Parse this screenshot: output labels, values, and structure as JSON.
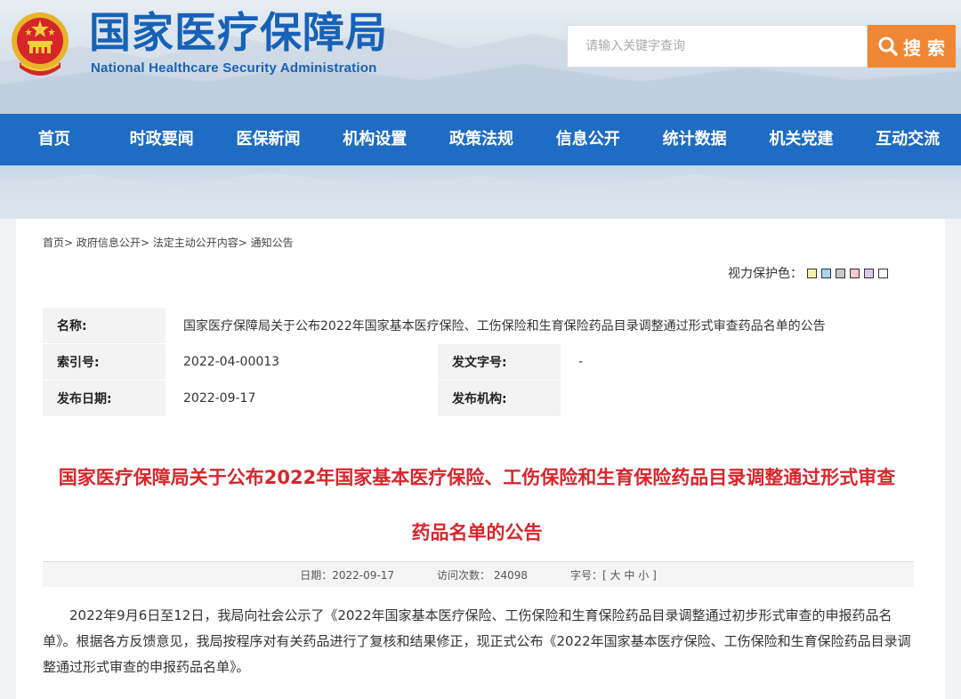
{
  "header": {
    "title": "国家医疗保障局",
    "subtitle": "National Healthcare Security Administration",
    "search_placeholder": "请输入关键字查询",
    "search_button": "搜 索"
  },
  "nav": {
    "items": [
      "首页",
      "时政要闻",
      "医保新闻",
      "机构设置",
      "政策法规",
      "信息公开",
      "统计数据",
      "机关党建",
      "互动交流"
    ]
  },
  "breadcrumb": {
    "items": [
      "首页>",
      "政府信息公开>",
      "法定主动公开内容>",
      "通知公告"
    ]
  },
  "eye_care": {
    "label": "视力保护色：",
    "colors": [
      "#f7f0a8",
      "#a7d6f0",
      "#c8c8c8",
      "#f4c6d0",
      "#d9c8ee",
      "#ffffff"
    ]
  },
  "meta": {
    "name_label": "名称:",
    "name_value": "国家医疗保障局关于公布2022年国家基本医疗保险、工伤保险和生育保险药品目录调整通过形式审查药品名单的公告",
    "index_label": "索引号:",
    "index_value": "2022-04-00013",
    "doc_no_label": "发文字号:",
    "doc_no_value": "-",
    "date_label": "发布日期:",
    "date_value": "2022-09-17",
    "org_label": "发布机构:",
    "org_value": ""
  },
  "article": {
    "title_line1": "国家医疗保障局关于公布2022年国家基本医疗保险、工伤保险和生育保险药品目录调整通过形式审查",
    "title_line2": "药品名单的公告",
    "date_label": "日期：2022-09-17",
    "visits_label": "访问次数：",
    "visits_value": "24098",
    "font_label": "字号：[",
    "font_big": "大",
    "font_mid": "中",
    "font_small": "小",
    "font_close": "]",
    "body": "2022年9月6日至12日，我局向社会公示了《2022年国家基本医疗保险、工伤保险和生育保险药品目录调整通过初步形式审查的申报药品名单》。根据各方反馈意见，我局按程序对有关药品进行了复核和结果修正，现正式公布《2022年国家基本医疗保险、工伤保险和生育保险药品目录调整通过形式审查的申报药品名单》。"
  },
  "colors": {
    "brand_blue": "#1762b8",
    "nav_blue": "#1e6cc3",
    "search_orange": "#f08734",
    "title_red": "#d8262c"
  }
}
